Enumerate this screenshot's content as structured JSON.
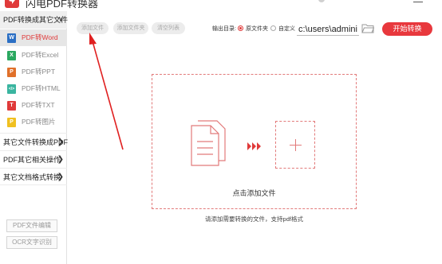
{
  "window": {
    "title": "闪电PDF转换器"
  },
  "sidebar": {
    "categories": [
      {
        "label": "PDF转换成其它文件",
        "items": [
          {
            "label": "PDF转Word",
            "icon": "W",
            "color": "#2b6fc4",
            "active": true
          },
          {
            "label": "PDF转Excel",
            "icon": "X",
            "color": "#2aa860",
            "active": false
          },
          {
            "label": "PDF转PPT",
            "icon": "P",
            "color": "#e0702a",
            "active": false
          },
          {
            "label": "PDF转HTML",
            "icon": "</>",
            "color": "#3ab5a0",
            "active": false
          },
          {
            "label": "PDF转TXT",
            "icon": "T",
            "color": "#e03a3a",
            "active": false
          },
          {
            "label": "PDF转图片",
            "icon": "P",
            "color": "#f0c020",
            "active": false
          }
        ]
      },
      {
        "label": "其它文件转换成PDF"
      },
      {
        "label": "PDF其它相关操作"
      },
      {
        "label": "其它文档格式转换"
      }
    ],
    "bottom_buttons": [
      "PDF文件编辑",
      "OCR文字识别"
    ]
  },
  "toolbar": {
    "add_file": "添加文件",
    "add_folder": "添加文件夹",
    "clear_list": "清空列表",
    "output_label": "输出目录:",
    "radio_original": "原文件夹",
    "radio_custom": "自定义",
    "path_value": "c:\\users\\administ",
    "start": "开始转换"
  },
  "dropzone": {
    "label": "点击添加文件",
    "hint": "请添加需要转换的文件，支持pdf格式"
  }
}
